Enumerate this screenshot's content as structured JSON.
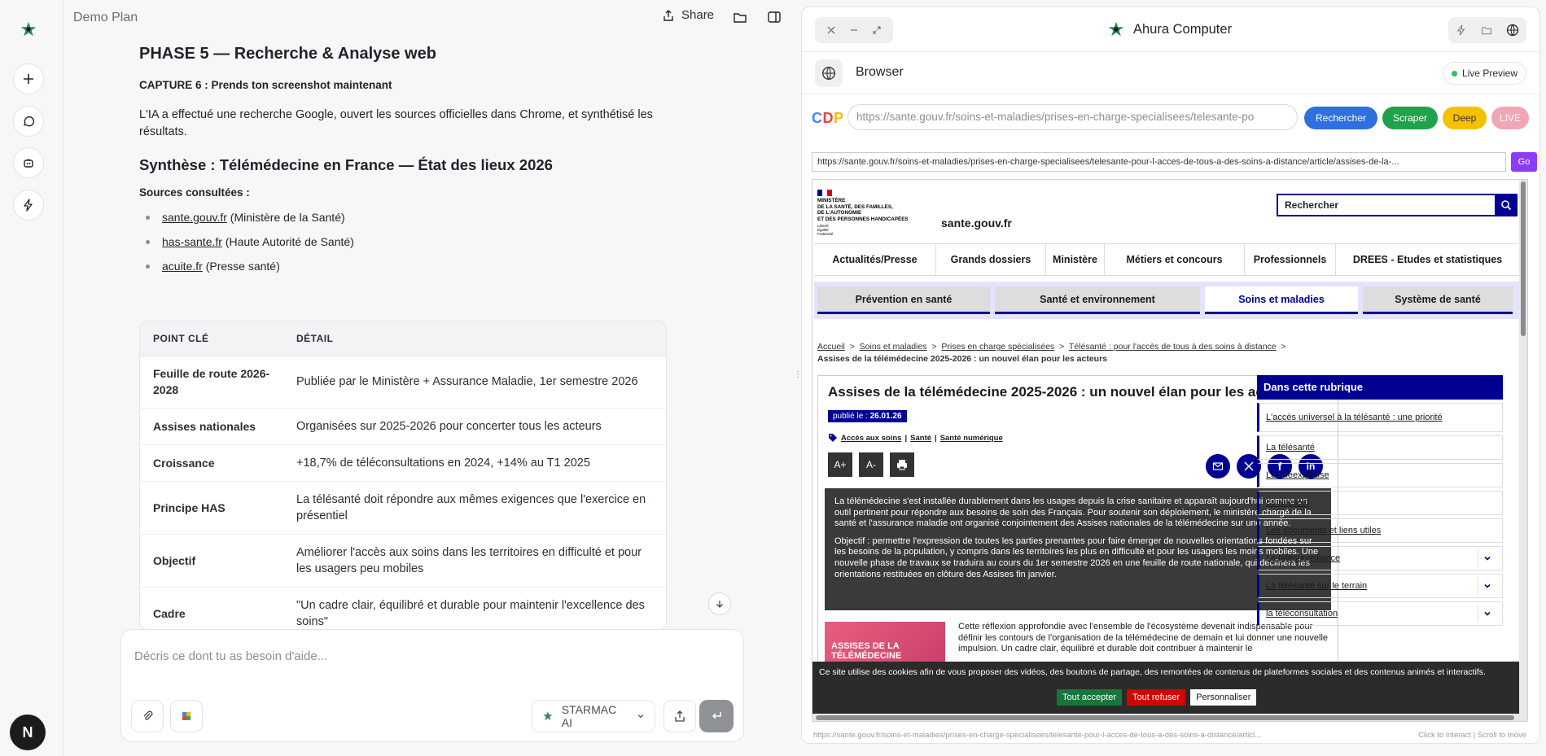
{
  "rail": {
    "avatar_letter": "N"
  },
  "chat": {
    "title": "Demo Plan",
    "share_label": "Share",
    "phase_title": "PHASE 5 — Recherche & Analyse web",
    "capture_label": "CAPTURE 6 : Prends ton screenshot maintenant",
    "intro": "L'IA a effectué une recherche Google, ouvert les sources officielles dans Chrome, et synthétisé les résultats.",
    "synthesis_title": "Synthèse : Télémédecine en France — État des lieux 2026",
    "sources_label": "Sources consultées :",
    "sources": [
      {
        "link": "sante.gouv.fr",
        "note": " (Ministère de la Santé)"
      },
      {
        "link": "has-sante.fr",
        "note": " (Haute Autorité de Santé)"
      },
      {
        "link": "acuite.fr",
        "note": " (Presse santé)"
      }
    ],
    "table": {
      "headers": [
        "POINT CLÉ",
        "DÉTAIL"
      ],
      "rows": [
        {
          "key": "Feuille de route 2026-2028",
          "detail": "Publiée par le Ministère + Assurance Maladie, 1er semestre 2026"
        },
        {
          "key": "Assises nationales",
          "detail": "Organisées sur 2025-2026 pour concerter tous les acteurs"
        },
        {
          "key": "Croissance",
          "detail": "+18,7% de téléconsultations en 2024, +14% au T1 2025"
        },
        {
          "key": "Principe HAS",
          "detail": "La télésanté doit répondre aux mêmes exigences que l'exercice en présentiel"
        },
        {
          "key": "Objectif",
          "detail": "Améliorer l'accès aux soins dans les territoires en difficulté et pour les usagers peu mobiles"
        },
        {
          "key": "Cadre",
          "detail": "\"Un cadre clair, équilibré et durable pour maintenir l'excellence des soins\""
        }
      ]
    },
    "composer_placeholder": "Décris ce dont tu as besoin d'aide...",
    "model_name": "STARMAC AI"
  },
  "panel": {
    "title": "Ahura Computer",
    "browser_label": "Browser",
    "live_preview": "Live Preview",
    "cdp": "CDP",
    "url_value": "https://sante.gouv.fr/soins-et-maladies/prises-en-charge-specialisees/telesante-po",
    "pills": {
      "rechercher": "Rechercher",
      "scraper": "Scraper",
      "deep": "Deep",
      "live": "LIVE"
    },
    "address": "https://sante.gouv.fr/soins-et-maladies/prises-en-charge-specialisees/telesante-pour-l-acces-de-tous-a-des-soins-a-distance/article/assises-de-la-...",
    "go": "Go",
    "status_url": "https://sante.gouv.fr/soins-et-maladies/prises-en-charge-specialisees/telesante-pour-l-acces-de-tous-a-des-soins-a-distance/articl...",
    "status_hint": "Click to interact | Scroll to move"
  },
  "site": {
    "ministry": [
      "MINISTÈRE",
      "DE LA SANTÉ, DES FAMILLES,",
      "DE L'AUTONOMIE",
      "ET DES PERSONNES HANDICAPÉES"
    ],
    "motto": [
      "Liberté",
      "Égalité",
      "Fraternité"
    ],
    "domain": "sante.gouv.fr",
    "search_label": "Rechercher",
    "nav1": [
      "Actualités/Presse",
      "Grands dossiers",
      "Ministère",
      "Métiers et concours",
      "Professionnels",
      "DREES - Etudes et statistiques"
    ],
    "nav2": [
      "Prévention en santé",
      "Santé et environnement",
      "Soins et maladies",
      "Système de santé"
    ],
    "crumbs": [
      "Accueil",
      "Soins et maladies",
      "Prises en charge spécialisées",
      "Télésanté : pour l'accès de tous à des soins à distance"
    ],
    "crumb_current": "Assises de la télémédecine 2025-2026 : un nouvel élan pour les acteurs",
    "article_title": "Assises de la télémédecine 2025-2026 : un nouvel élan pour les acteurs",
    "published_label": "publié le : ",
    "published_date": "26.01.26",
    "tags": [
      "Accès aux soins",
      "Santé",
      "Santé numérique"
    ],
    "font_up": "A+",
    "font_down": "A-",
    "lead_p1": "La télémédecine s'est installée durablement dans les usages depuis la crise sanitaire et apparaît aujourd'hui comme un outil pertinent pour répondre aux besoins de soin des Français. Pour soutenir son déploiement, le ministère chargé de la santé et l'assurance maladie ont organisé conjointement des Assises nationales de la télémédecine sur une année.",
    "lead_p2": "Objectif : permettre l'expression de toutes les parties prenantes pour faire émerger de nouvelles orientations fondées sur les besoins de la population, y compris dans les territoires les plus en difficulté et pour les usagers les moins mobiles. Une nouvelle phase de travaux se traduira au cours du 1er semestre 2026 en une feuille de route nationale, qui déclinera les orientations restituées en clôture des Assises fin janvier.",
    "promo_text": "ASSISES DE LA TÉLÉMÉDECINE",
    "body_text": "Cette réflexion approfondie avec l'ensemble de l'écosystème devenait indispensable pour définir les contours de l'organisation de la télémédecine de demain et lui donner une nouvelle impulsion. Un cadre clair, équilibré et durable doit contribuer à maintenir le",
    "side_title": "Dans cette rubrique",
    "side_items": [
      "L'accès universel à la télésanté : une priorité",
      "La télésanté",
      "La téléexpertise",
      "Le télésoin",
      "Les documents et liens utiles",
      "La télésurveillance",
      "La télésanté sur le terrain",
      "la téléconsultation"
    ],
    "cookie_text": "Ce site utilise des cookies afin de vous proposer des vidéos, des boutons de partage, des remontées de contenus de plateformes sociales et des contenus animés et interactifs.",
    "cookie_accept": "Tout accepter",
    "cookie_refuse": "Tout refuser",
    "cookie_custom": "Personnaliser"
  },
  "colors": {
    "accent_blue": "#2f6fe0",
    "scraper_green": "#20a24a",
    "deep_yellow": "#f5c000",
    "live_pink": "#f0a7b3",
    "go_purple": "#8d3cf5",
    "gov_blue": "#000091"
  }
}
